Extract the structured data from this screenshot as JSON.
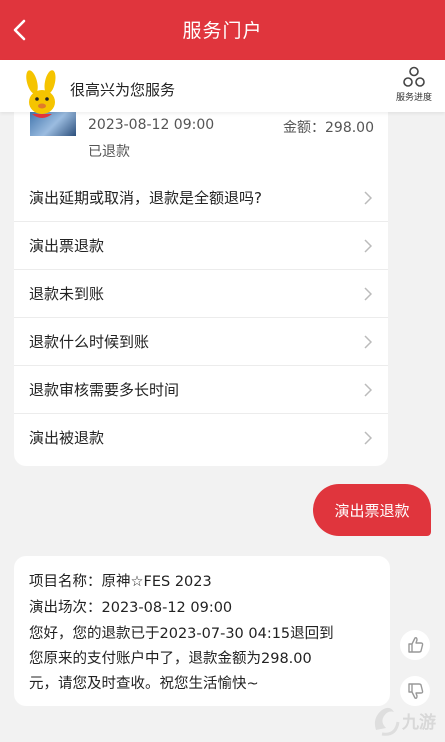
{
  "header": {
    "title": "服务门户"
  },
  "welcome": {
    "text": "很高兴为您服务",
    "progress_label": "服务进度"
  },
  "order": {
    "date": "2023-08-12 09:00",
    "amount": "金额：298.00",
    "status": "已退款"
  },
  "faq": [
    {
      "label": "演出延期或取消，退款是全额退吗?"
    },
    {
      "label": "演出票退款"
    },
    {
      "label": "退款未到账"
    },
    {
      "label": "退款什么时候到账"
    },
    {
      "label": "退款审核需要多长时间"
    },
    {
      "label": "演出被退款"
    }
  ],
  "user_message": "演出票退款",
  "reply": {
    "project": "项目名称：原神☆FES 2023",
    "session": "演出场次：2023-08-12 09:00",
    "lines": [
      "您好，您的退款已于2023-07-30 04:15退回到",
      "您原来的支付账户中了，退款金额为298.00",
      "元，请您及时查收。祝您生活愉快~"
    ]
  },
  "colors": {
    "accent": "#e0353d",
    "background": "#f2f2f2"
  },
  "icons": {
    "back": "chevron-left-icon",
    "progress": "service-progress-icon",
    "like": "thumbs-up-icon",
    "dislike": "thumbs-down-icon"
  }
}
